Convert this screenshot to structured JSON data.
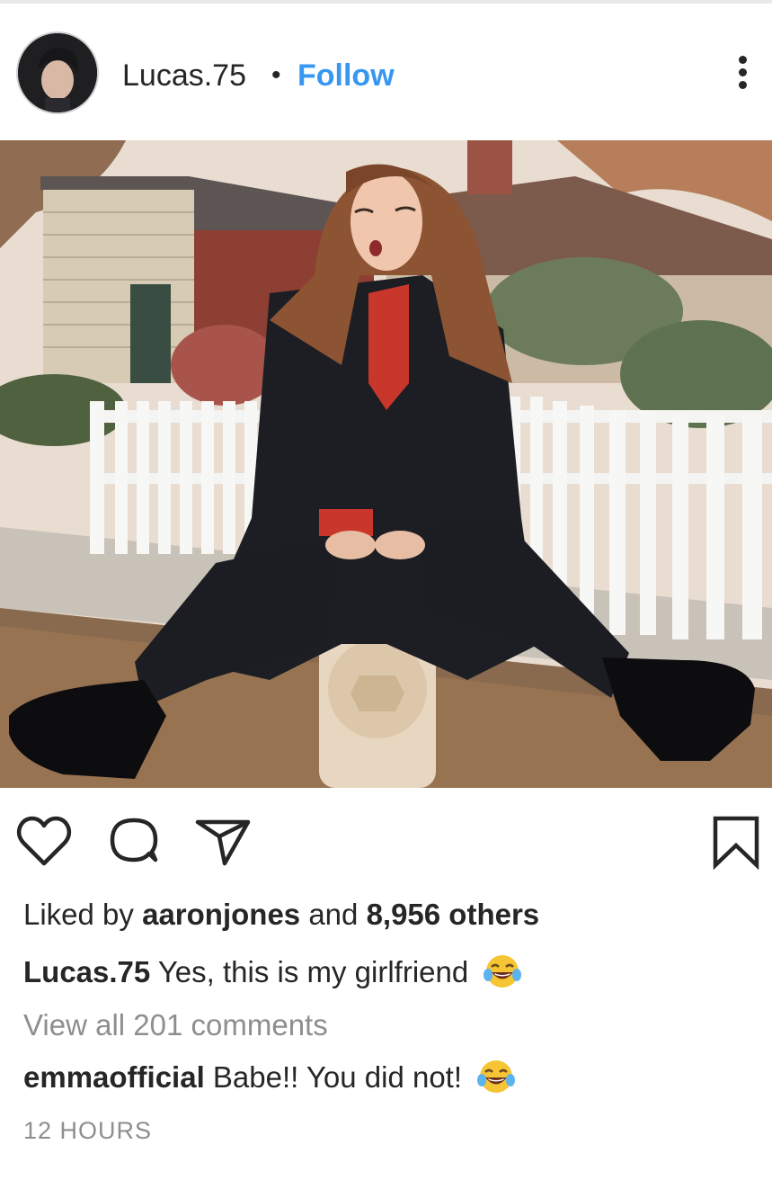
{
  "post": {
    "username": "Lucas.75",
    "separator": "•",
    "follow_label": "Follow"
  },
  "icons": {
    "more": "more-options-icon",
    "like": "heart-icon",
    "comment": "comment-icon",
    "share": "share-icon",
    "save": "bookmark-icon",
    "emoji": "laughing-tears-emoji"
  },
  "likes": {
    "prefix": "Liked by",
    "liker": "aaronjones",
    "joiner": "and",
    "others": "8,956 others"
  },
  "caption": {
    "username": "Lucas.75",
    "text": "Yes, this is my girlfriend"
  },
  "view_comments_label": "View all 201 comments",
  "comment": {
    "username": "emmaofficial",
    "text": "Babe!! You did not!"
  },
  "timestamp": "12 HOURS",
  "colors": {
    "link_blue": "#3897f0",
    "text": "#262626",
    "muted": "#8e8e8e"
  }
}
